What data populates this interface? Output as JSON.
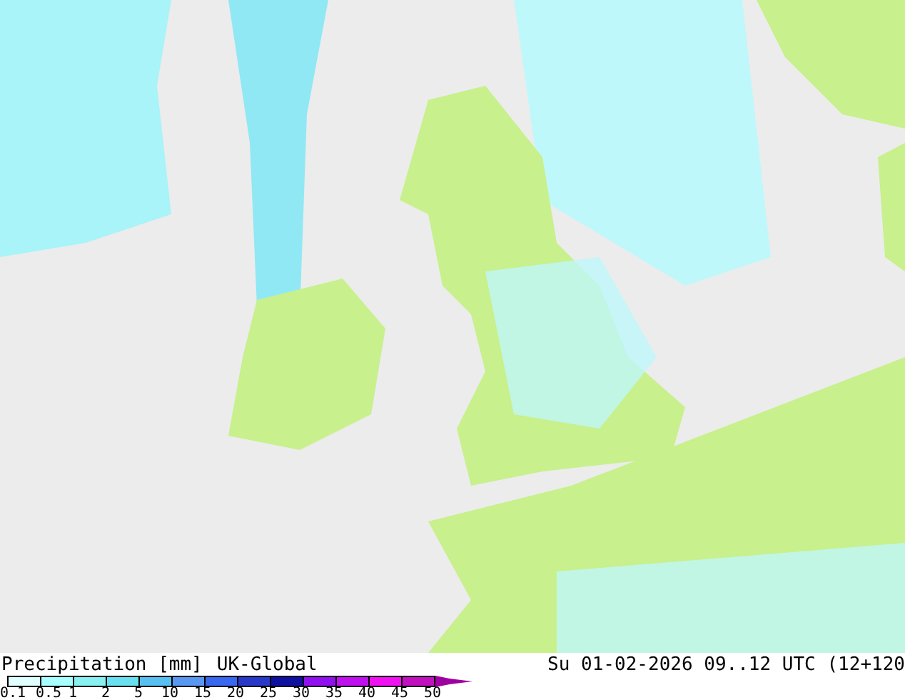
{
  "title": "Precipitation [mm]",
  "model": "UK-Global",
  "valid_time": "Su 01-02-2026 09..12 UTC (12+120",
  "legend": {
    "colors": [
      {
        "color": "#e0ffff"
      },
      {
        "color": "#a8ffff"
      },
      {
        "color": "#88f0f0"
      },
      {
        "color": "#68e0f0"
      },
      {
        "color": "#58c0f0"
      },
      {
        "color": "#5898f0"
      },
      {
        "color": "#3868f0"
      },
      {
        "color": "#2838c8"
      },
      {
        "color": "#1010a0"
      },
      {
        "color": "#9010f0"
      },
      {
        "color": "#c010f0"
      },
      {
        "color": "#f010f0"
      },
      {
        "color": "#c010c0"
      }
    ],
    "ticks": [
      "0.1",
      "0.5",
      "1",
      "2",
      "5",
      "10",
      "15",
      "20",
      "25",
      "30",
      "35",
      "40",
      "45",
      "50"
    ],
    "arrow": {
      "color": "#a000a0"
    }
  }
}
